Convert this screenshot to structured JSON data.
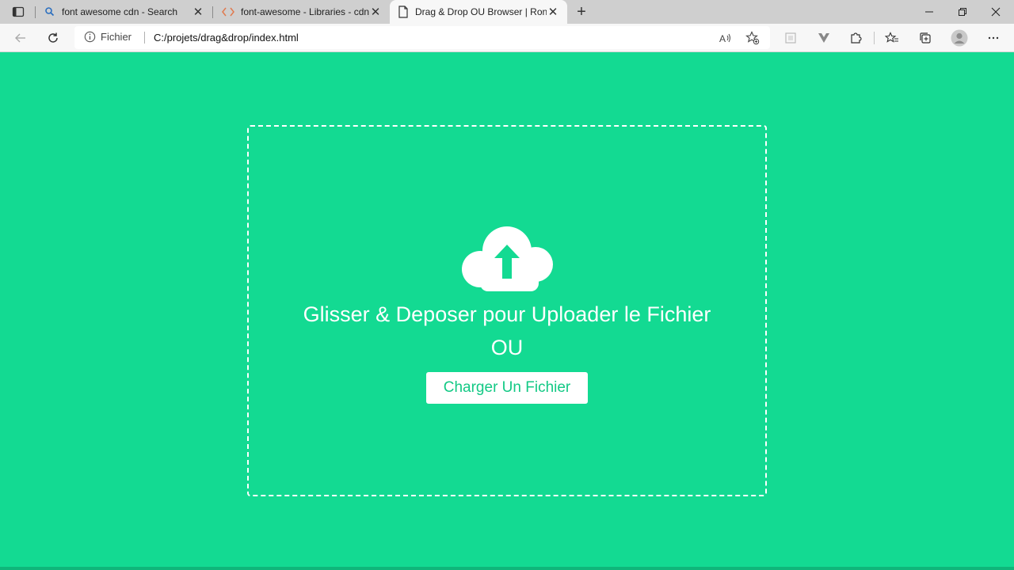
{
  "tabs": [
    {
      "title": "font awesome cdn - Search",
      "icon": "search-icon",
      "active": false
    },
    {
      "title": "font-awesome - Libraries - cdnjs",
      "icon": "code-brackets-icon",
      "active": false
    },
    {
      "title": "Drag & Drop OU Browser | Rona",
      "icon": "document-icon",
      "active": true
    }
  ],
  "address_bar": {
    "site_label": "Fichier",
    "url": "C:/projets/drag&drop/index.html"
  },
  "page": {
    "headline": "Glisser & Deposer pour Uploader le Fichier",
    "separator_text": "OU",
    "upload_button_label": "Charger Un Fichier"
  },
  "colors": {
    "page_background": "#13da92",
    "button_text": "#13c985",
    "dropzone_border": "#ffffff"
  }
}
